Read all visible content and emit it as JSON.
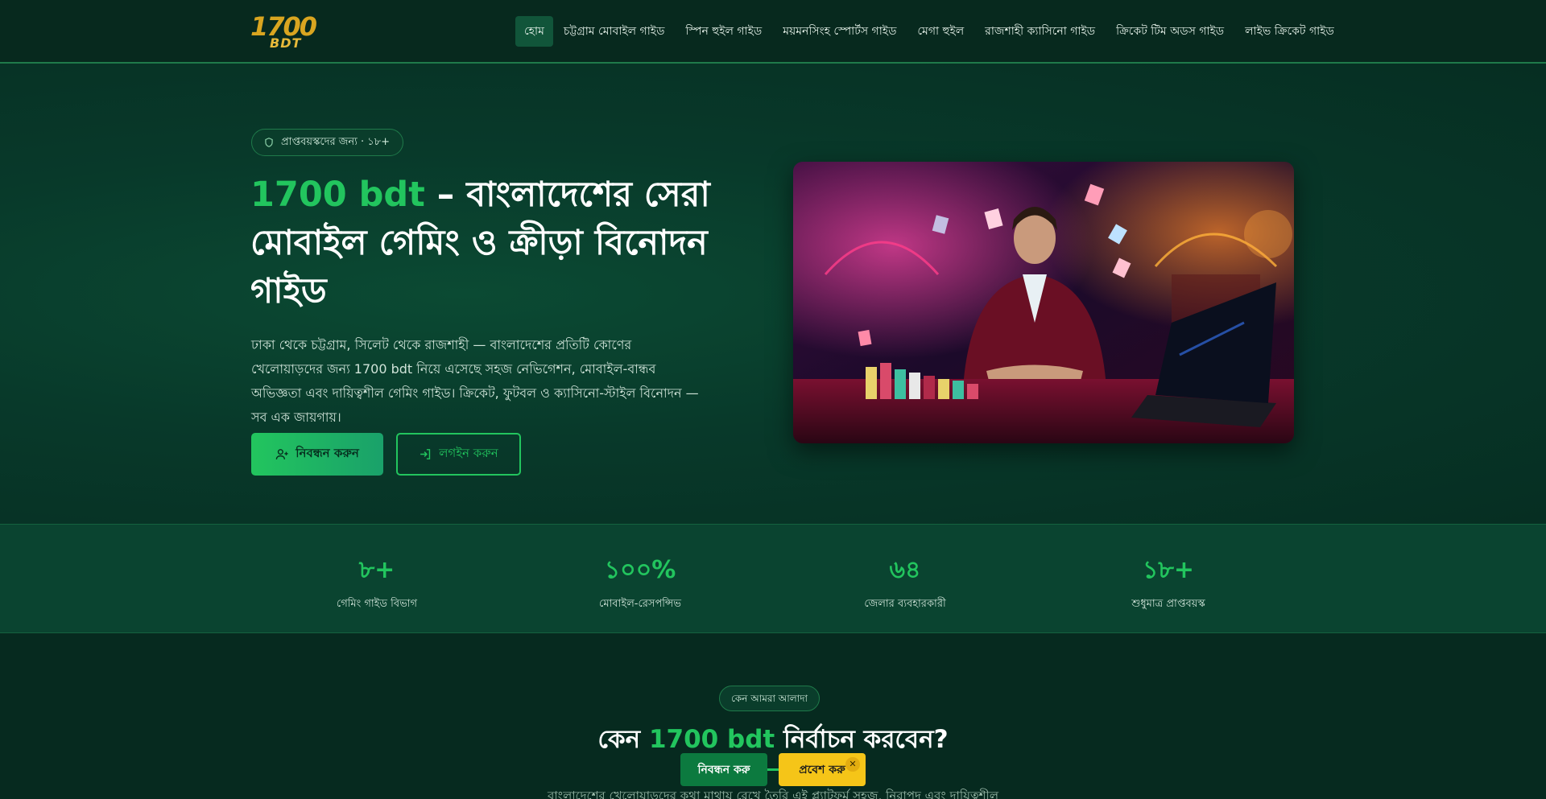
{
  "brand": {
    "logo_top": "1700",
    "logo_bottom": "BDT"
  },
  "nav": {
    "items": [
      "হোম",
      "চট্টগ্রাম মোবাইল গাইড",
      "স্পিন হুইল গাইড",
      "ময়মনসিংহ স্পোর্টস গাইড",
      "মেগা হুইল",
      "রাজশাহী ক্যাসিনো গাইড",
      "ক্রিকেট টিম অডস গাইড",
      "লাইভ ক্রিকেট গাইড"
    ]
  },
  "hero": {
    "badge": "প্রাপ্তবয়স্কদের জন্য · ১৮+",
    "title_accent": "1700 bdt",
    "title_rest": " – বাংলাদেশের সেরা মোবাইল গেমিং ও ক্রীড়া বিনোদন গাইড",
    "lead": "ঢাকা থেকে চট্টগ্রাম, সিলেট থেকে রাজশাহী — বাংলাদেশের প্রতিটি কোণের খেলোয়াড়দের জন্য 1700 bdt নিয়ে এসেছে সহজ নেভিগেশন, মোবাইল-বান্ধব অভিজ্ঞতা এবং দায়িত্বশীল গেমিং গাইড। ক্রিকেট, ফুটবল ও ক্যাসিনো-স্টাইল বিনোদন — সব এক জায়গায়।",
    "register_label": "নিবন্ধন করুন",
    "login_label": "লগইন করুন"
  },
  "stats": [
    {
      "num": "৮+",
      "label": "গেমিং গাইড বিভাগ"
    },
    {
      "num": "১০০%",
      "label": "মোবাইল-রেসপন্সিভ"
    },
    {
      "num": "৬৪",
      "label": "জেলার ব্যবহারকারী"
    },
    {
      "num": "১৮+",
      "label": "শুধুমাত্র প্রাপ্তবয়স্ক"
    }
  ],
  "why": {
    "badge": "কেন আমরা আলাদা",
    "title_pre": "কেন ",
    "title_accent": "1700 bdt",
    "title_post": " নির্বাচন করবেন?",
    "subtitle": "বাংলাদেশের খেলোয়াড়দের কথা মাথায় রেখে তৈরি এই প্ল্যাটফর্ম সহজ, নিরাপদ এবং দায়িত্বশীল"
  },
  "sticky": {
    "register": "নিবন্ধন করু",
    "login": "প্রবেশ করু",
    "close": "✕"
  },
  "colors": {
    "accent": "#22c55e",
    "bg": "#062a1f",
    "sticky_login": "#f5c518",
    "sticky_register": "#0c7a3f"
  }
}
